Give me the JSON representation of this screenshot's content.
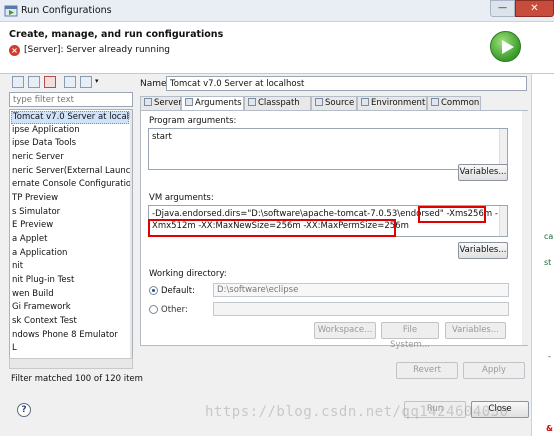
{
  "window": {
    "title": "Run Configurations",
    "minimize_glyph": "—",
    "close_glyph": "✕"
  },
  "header": {
    "title": "Create, manage, and run configurations",
    "error_icon": "error-icon",
    "message": "[Server]: Server already running",
    "banner_icon": "run-icon"
  },
  "left": {
    "toolbar_icons": [
      "new-config-icon",
      "duplicate-icon",
      "delete-icon",
      "collapse-all-icon",
      "filter-icon"
    ],
    "filter_placeholder": "type filter text",
    "tree_items": [
      "Tomcat v7.0 Server at localh",
      "ipse Application",
      "ipse Data Tools",
      "neric Server",
      "neric Server(External Launch)",
      "ernate Console Configuratio",
      "TP Preview",
      "s Simulator",
      "E Preview",
      "a Applet",
      "a Application",
      "nit",
      "nit Plug-in Test",
      "wen Build",
      "Gi Framework",
      "sk Context Test",
      "ndows Phone 8 Emulator",
      "L"
    ],
    "filter_status": "Filter matched 100 of 120 item"
  },
  "right": {
    "name_label": "Name:",
    "name_value": "Tomcat v7.0 Server at localhost",
    "tabs": [
      {
        "label": "Server",
        "icon": "server-icon"
      },
      {
        "label": "Arguments",
        "icon": "arguments-icon",
        "active": true
      },
      {
        "label": "Classpath",
        "icon": "classpath-icon"
      },
      {
        "label": "Source",
        "icon": "source-icon"
      },
      {
        "label": "Environment",
        "icon": "environment-icon"
      },
      {
        "label": "Common",
        "icon": "common-icon"
      }
    ],
    "program_args_label": "Program arguments:",
    "program_args_value": "start",
    "variables_label": "Variables...",
    "vm_args_label": "VM arguments:",
    "vm_args_line1": "-Djava.endorsed.dirs=\"D:\\software\\apache-tomcat-7.0.53\\endorsed\" -Xms256m -",
    "vm_args_line2": "Xmx512m -XX:MaxNewSize=256m -XX:MaxPermSize=256m",
    "working_dir_label": "Working directory:",
    "default_label": "Default:",
    "default_value": "D:\\software\\eclipse",
    "other_label": "Other:",
    "workspace_label": "Workspace...",
    "filesystem_label": "File System...",
    "revert_label": "Revert",
    "apply_label": "Apply"
  },
  "footer": {
    "help_glyph": "?",
    "run_label": "Run",
    "close_label": "Close",
    "watermark": "https://blog.csdn.net/qq1424604030"
  },
  "background_fragments": [
    "ca",
    "st",
    "-",
    "&"
  ]
}
